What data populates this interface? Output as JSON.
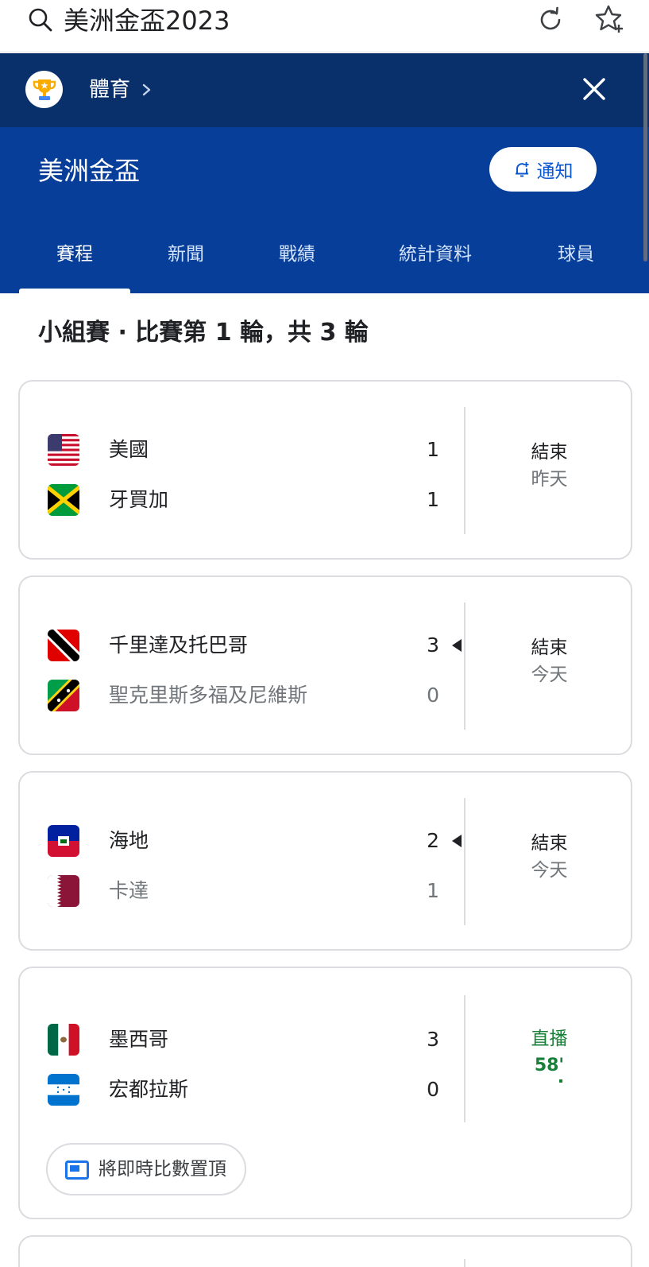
{
  "search": {
    "query": "美洲金盃2023"
  },
  "breadcrumb": {
    "label": "體育"
  },
  "competition": {
    "title": "美洲金盃",
    "notify_label": "通知"
  },
  "tabs": [
    "賽程",
    "新聞",
    "戰績",
    "統計資料",
    "球員"
  ],
  "section_title": "小組賽 · 比賽第 1 輪，共 3 輪",
  "matches": [
    {
      "home": {
        "name": "美國",
        "score": "1",
        "flag": "usa-flag"
      },
      "away": {
        "name": "牙買加",
        "score": "1",
        "flag": "jamaica-flag"
      },
      "status": "結束",
      "when": "昨天",
      "winner": "none"
    },
    {
      "home": {
        "name": "千里達及托巴哥",
        "score": "3",
        "flag": "trinidad-tobago-flag"
      },
      "away": {
        "name": "聖克里斯多福及尼維斯",
        "score": "0",
        "flag": "saint-kitts-nevis-flag"
      },
      "status": "結束",
      "when": "今天",
      "winner": "home"
    },
    {
      "home": {
        "name": "海地",
        "score": "2",
        "flag": "haiti-flag"
      },
      "away": {
        "name": "卡達",
        "score": "1",
        "flag": "qatar-flag"
      },
      "status": "結束",
      "when": "今天",
      "winner": "home"
    },
    {
      "home": {
        "name": "墨西哥",
        "score": "3",
        "flag": "mexico-flag"
      },
      "away": {
        "name": "宏都拉斯",
        "score": "0",
        "flag": "honduras-flag"
      },
      "status": "直播",
      "when": "58'",
      "winner": "live"
    }
  ],
  "pin_label": "將即時比數置頂",
  "colors": {
    "header_dark": "#0a306c",
    "header": "#073e9a",
    "live_green": "#188038",
    "link_blue": "#0b57d0"
  }
}
